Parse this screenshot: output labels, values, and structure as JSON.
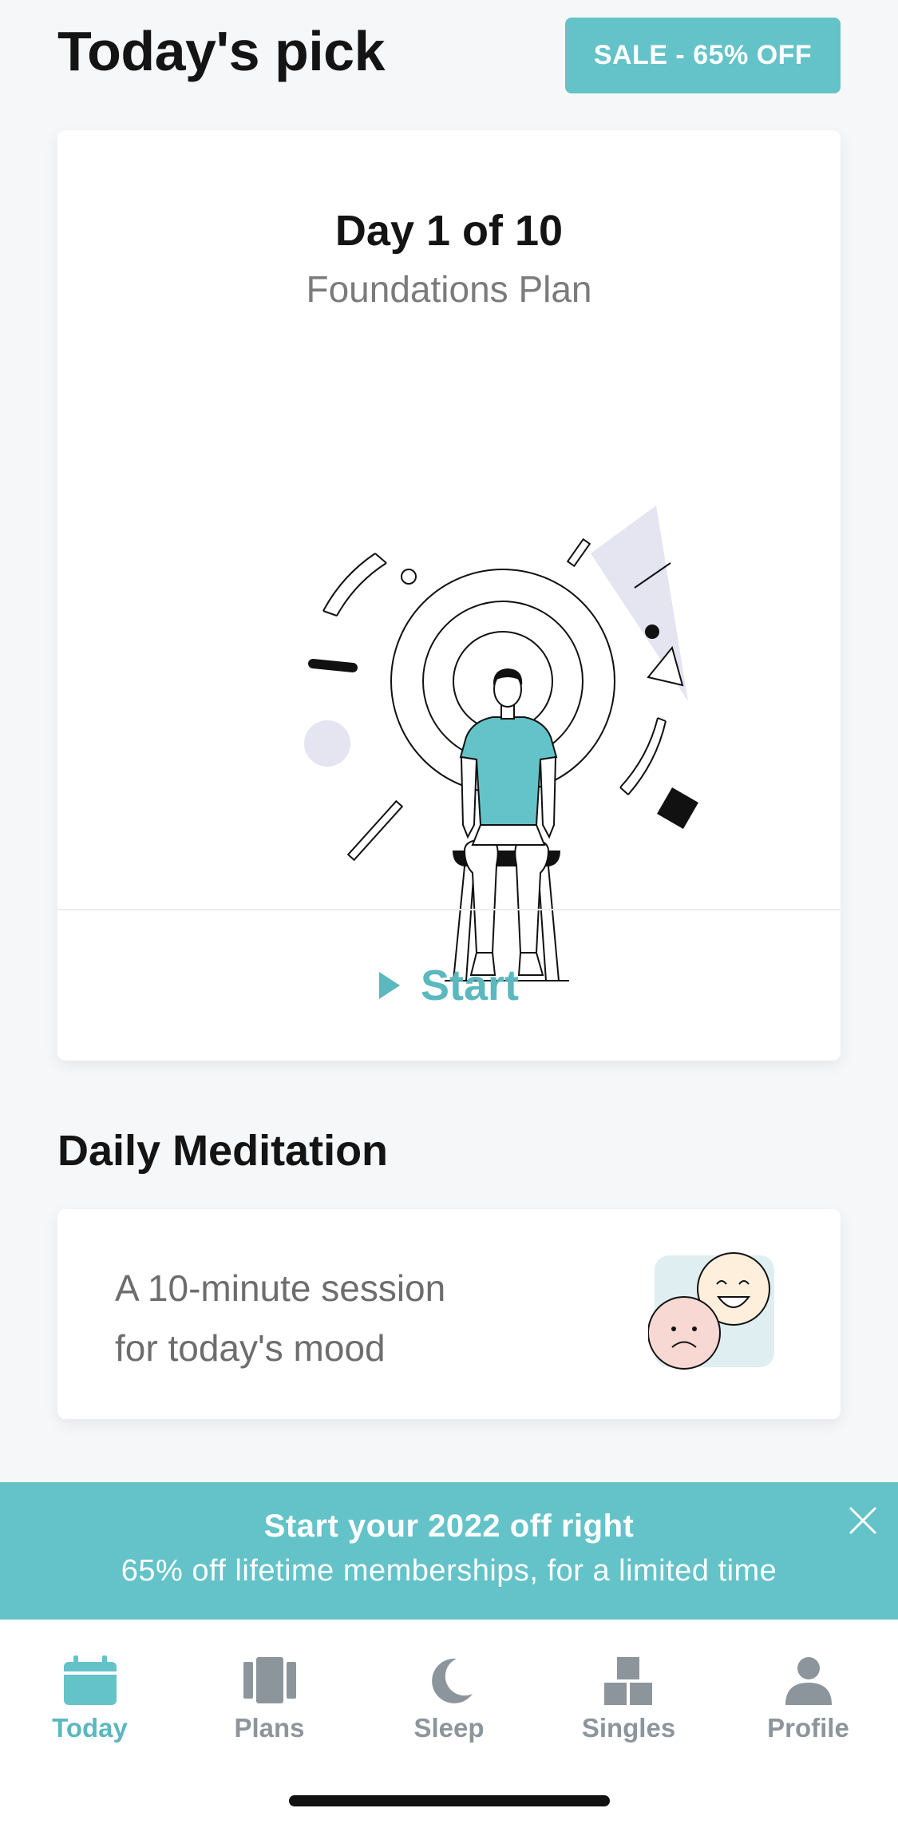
{
  "header": {
    "title": "Today's pick",
    "sale_badge": "SALE - 65% OFF"
  },
  "featured_card": {
    "day_label": "Day 1 of 10",
    "plan_name": "Foundations Plan",
    "start_label": "Start"
  },
  "daily_meditation": {
    "section_title": "Daily Meditation",
    "line1": "A 10-minute session",
    "line2": "for today's mood"
  },
  "promo_banner": {
    "title": "Start your 2022 off right",
    "subtitle": "65% off lifetime memberships, for a limited time"
  },
  "tabbar": {
    "tabs": [
      {
        "label": "Today",
        "icon": "calendar-icon",
        "active": true
      },
      {
        "label": "Plans",
        "icon": "plans-icon",
        "active": false
      },
      {
        "label": "Sleep",
        "icon": "moon-icon",
        "active": false
      },
      {
        "label": "Singles",
        "icon": "blocks-icon",
        "active": false
      },
      {
        "label": "Profile",
        "icon": "person-icon",
        "active": false
      }
    ]
  },
  "colors": {
    "accent": "#63c3c8",
    "accent_text": "#5bb8be",
    "inactive_tab": "#8d959c",
    "background": "#f6f7f9"
  }
}
